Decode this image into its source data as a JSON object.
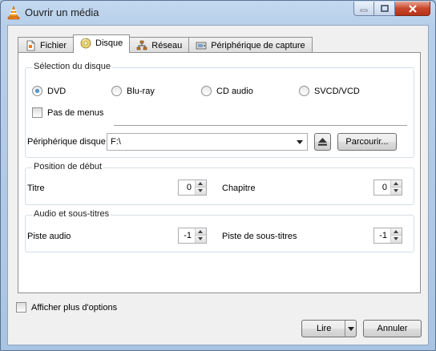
{
  "window": {
    "title": "Ouvrir un média"
  },
  "tabs": [
    {
      "label": "Fichier",
      "icon": "file-icon"
    },
    {
      "label": "Disque",
      "icon": "disc-icon"
    },
    {
      "label": "Réseau",
      "icon": "network-icon"
    },
    {
      "label": "Périphérique de capture",
      "icon": "capture-device-icon"
    }
  ],
  "active_tab": "Disque",
  "disc_selection": {
    "label": "Sélection du disque",
    "options": [
      {
        "label": "DVD",
        "selected": true
      },
      {
        "label": "Blu-ray",
        "selected": false
      },
      {
        "label": "CD audio",
        "selected": false
      },
      {
        "label": "SVCD/VCD",
        "selected": false
      }
    ],
    "no_menus_label": "Pas de menus",
    "no_menus_checked": false,
    "device_label": "Périphérique disque",
    "device_value": "F:\\",
    "browse_label": "Parcourir..."
  },
  "start_position": {
    "label": "Position de début",
    "title_label": "Titre",
    "title_value": "0",
    "chapter_label": "Chapitre",
    "chapter_value": "0"
  },
  "audio_subtitles": {
    "label": "Audio et sous-titres",
    "audio_label": "Piste audio",
    "audio_value": "-1",
    "subtitle_label": "Piste de sous-titres",
    "subtitle_value": "-1"
  },
  "footer": {
    "more_options_label": "Afficher plus d'options",
    "more_options_checked": false,
    "play_label": "Lire",
    "cancel_label": "Annuler"
  }
}
